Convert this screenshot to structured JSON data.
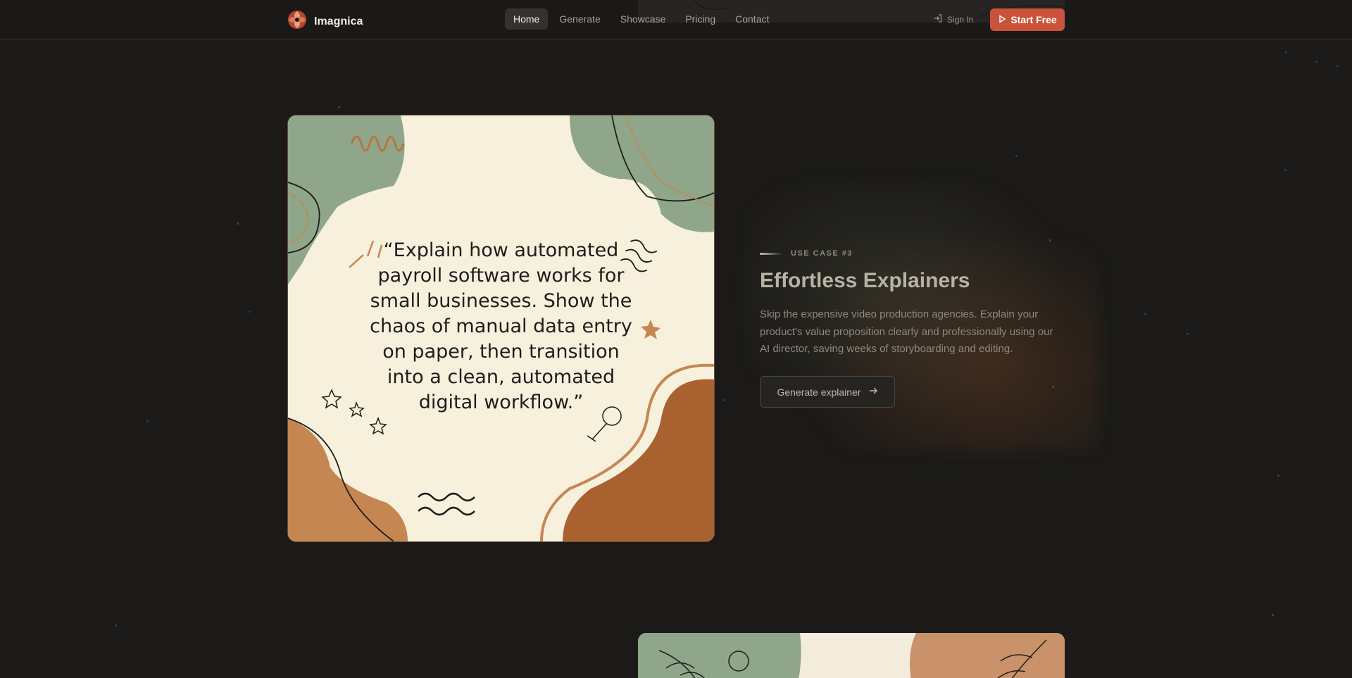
{
  "nav": {
    "brand": "Imagnica",
    "links": [
      "Home",
      "Generate",
      "Showcase",
      "Pricing",
      "Contact"
    ],
    "active": "Home",
    "sign_in": "Sign In",
    "start_free": "Start Free"
  },
  "feature": {
    "use_case_label": "USE CASE #3",
    "headline": "Effortless Explainers",
    "description": "Skip the expensive video production agencies. Explain your product's value proposition clearly and professionally using our AI director, saving weeks of storyboarding and editing.",
    "button_label": "Generate explainer",
    "image_quote": "“Explain how automated payroll software works for small businesses. Show the chaos of manual data entry on paper, then transition into a clean, automated digital workflow.”"
  },
  "colors": {
    "background": "#1b1a18",
    "accent": "#c9533a",
    "sage": "#8fa68a",
    "terracotta": "#c68652",
    "cream": "#f6f0dd"
  }
}
